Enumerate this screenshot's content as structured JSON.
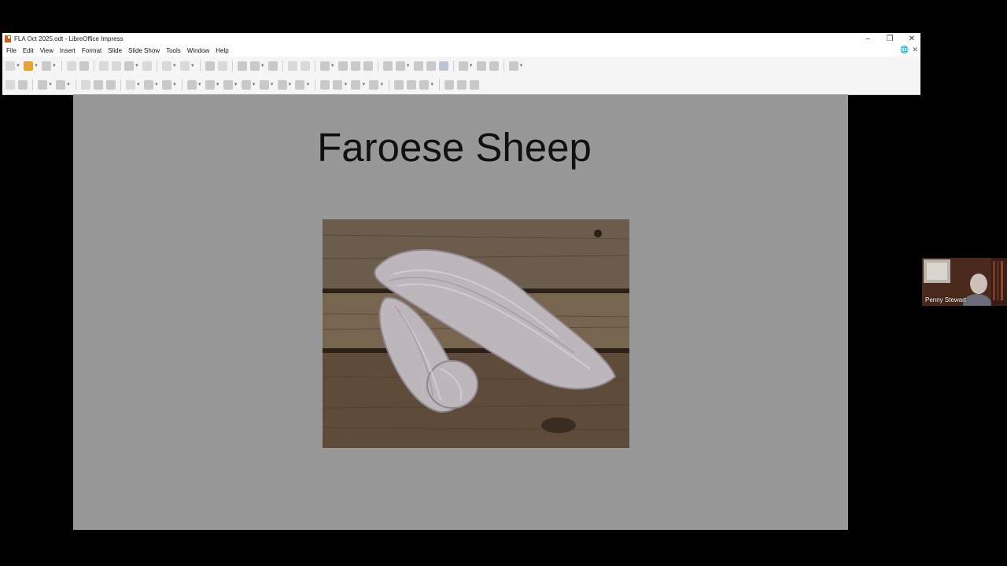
{
  "window": {
    "title": "FLA Oct 2025.odt - LibreOffice Impress",
    "controls": [
      "–",
      "❐",
      "✕"
    ]
  },
  "menu": [
    "File",
    "Edit",
    "View",
    "Insert",
    "Format",
    "Slide",
    "Slide Show",
    "Tools",
    "Window",
    "Help"
  ],
  "menu_right": [
    "🌐",
    "✕"
  ],
  "slide": {
    "title": "Faroese Sheep"
  },
  "video": {
    "participant_name": "Penny Stewart"
  },
  "colors": {
    "slide_bg": "#989898",
    "screen_bg": "#000000",
    "toolbar_bg": "#f5f5f5"
  }
}
